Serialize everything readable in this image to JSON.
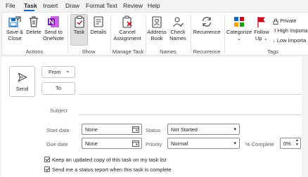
{
  "menu": [
    "File",
    "Task",
    "Insert",
    "Draw",
    "Format Text",
    "Review",
    "Help"
  ],
  "ribbon": {
    "actions": {
      "save_close_1": "Save &",
      "save_close_2": "Close",
      "delete": "Delete",
      "send_onenote_1": "Send to",
      "send_onenote_2": "OneNote",
      "label": "Actions"
    },
    "show": {
      "task": "Task",
      "details": "Details",
      "label": "Show"
    },
    "manage": {
      "cancel_1": "Cancel",
      "cancel_2": "Assignment",
      "label": "Manage Task"
    },
    "names": {
      "address_1": "Address",
      "address_2": "Book",
      "check_1": "Check",
      "check_2": "Names",
      "label": "Names"
    },
    "recurrence": {
      "btn": "Recurrence",
      "label": "Recurrence"
    },
    "tags": {
      "categorize": "Categorize",
      "follow_1": "Follow",
      "follow_2": "Up",
      "private": "Private",
      "high": "High Importa",
      "low": "Low Importa",
      "label": "Tags"
    }
  },
  "form": {
    "send": "Send",
    "from": "From",
    "to": "To",
    "subject": "Subject",
    "start_date_label": "Start date",
    "start_date_value": "None",
    "status_label": "Status",
    "status_value": "Not Started",
    "due_date_label": "Due date",
    "due_date_value": "None",
    "priority_label": "Priority",
    "priority_value": "Normal",
    "complete_label": "% Complete",
    "complete_value": "0%",
    "keep_copy": "Keep an updated copy of this task on my task list",
    "send_report": "Send me a status report when this task is complete"
  },
  "colors": {
    "accent": "#0f6cbd",
    "onenote": "#7719aa",
    "high_importance": "#c50f1f",
    "low_importance": "#0f6cbd"
  }
}
